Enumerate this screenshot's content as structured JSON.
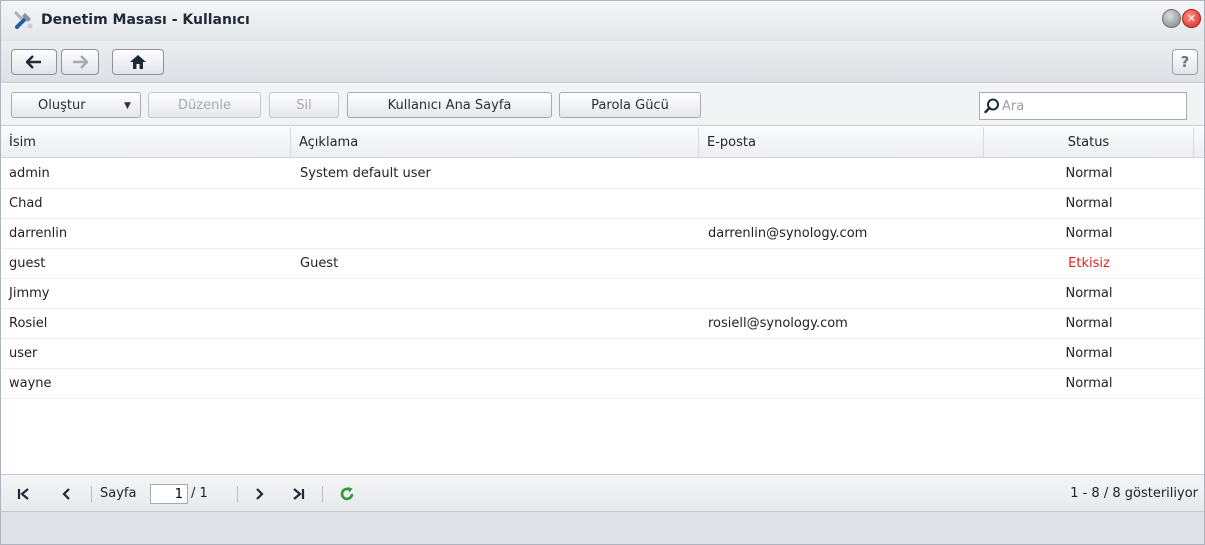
{
  "window": {
    "title": "Denetim Masası - Kullanıcı",
    "app_icon": "control-panel-tools-icon",
    "help_label": "?"
  },
  "toolbar": {
    "create_label": "Oluştur",
    "edit_label": "Düzenle",
    "delete_label": "Sil",
    "user_home_label": "Kullanıcı Ana Sayfa",
    "password_strength_label": "Parola Gücü",
    "search_placeholder": "Ara"
  },
  "grid": {
    "columns": {
      "name": "İsim",
      "description": "Açıklama",
      "email": "E-posta",
      "status": "Status"
    },
    "rows": [
      {
        "name": "admin",
        "description": "System default user",
        "email": "",
        "status": "Normal",
        "inactive": false
      },
      {
        "name": "Chad",
        "description": "",
        "email": "",
        "status": "Normal",
        "inactive": false
      },
      {
        "name": "darrenlin",
        "description": "",
        "email": "darrenlin@synology.com",
        "status": "Normal",
        "inactive": false
      },
      {
        "name": "guest",
        "description": "Guest",
        "email": "",
        "status": "Etkisiz",
        "inactive": true
      },
      {
        "name": "Jimmy",
        "description": "",
        "email": "",
        "status": "Normal",
        "inactive": false
      },
      {
        "name": "Rosiel",
        "description": "",
        "email": "rosiell@synology.com",
        "status": "Normal",
        "inactive": false
      },
      {
        "name": "user",
        "description": "",
        "email": "",
        "status": "Normal",
        "inactive": false
      },
      {
        "name": "wayne",
        "description": "",
        "email": "",
        "status": "Normal",
        "inactive": false
      }
    ]
  },
  "pager": {
    "page_label": "Sayfa",
    "current_page": "1",
    "total_pages": "/ 1",
    "info": "1 - 8 / 8 gösteriliyor"
  },
  "colors": {
    "inactive_status": "#e0241a",
    "refresh_icon": "#2e9a2e",
    "close_button": "#d32a1f"
  }
}
